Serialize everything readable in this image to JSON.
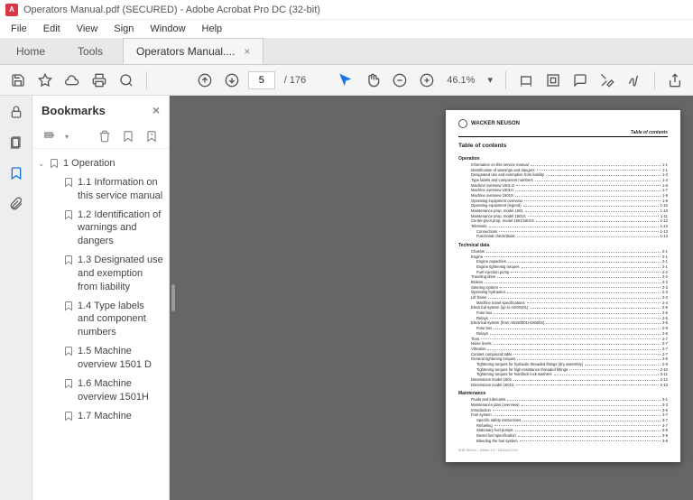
{
  "window": {
    "title": "Operators Manual.pdf (SECURED) - Adobe Acrobat Pro DC (32-bit)",
    "app_icon": "A"
  },
  "menu": {
    "file": "File",
    "edit": "Edit",
    "view": "View",
    "sign": "Sign",
    "window": "Window",
    "help": "Help"
  },
  "tabs": {
    "home": "Home",
    "tools": "Tools",
    "doc": "Operators Manual....",
    "close": "×"
  },
  "toolbar": {
    "page": "5",
    "total_pages": "/ 176",
    "zoom": "46.1%",
    "dropdown": "▾"
  },
  "sidebar": {
    "title": "Bookmarks",
    "close": "×",
    "root": "1 Operation",
    "items": [
      "1.1 Information on this service manual",
      "1.2 Identification of warnings and dangers",
      "1.3 Designated use and exemption from liability",
      "1.4 Type labels and component numbers",
      "1.5 Machine overview 1501 D",
      "1.6 Machine overview 1501H",
      "1.7 Machine"
    ]
  },
  "doc": {
    "brand": "WACKER NEUSON",
    "header_right": "Table of contents",
    "toc_title": "Table of contents",
    "sections": [
      {
        "title": "Operation",
        "rows": [
          {
            "t": "Information on this service manual",
            "p": "1-1",
            "i": 1
          },
          {
            "t": "Identification of warnings and dangers",
            "p": "1-1",
            "i": 1
          },
          {
            "t": "Designated use and exemption from liability",
            "p": "1-3",
            "i": 1
          },
          {
            "t": "Type labels and component numbers",
            "p": "1-4",
            "i": 1
          },
          {
            "t": "Machine overview 1501 D",
            "p": "1-6",
            "i": 1
          },
          {
            "t": "Machine overview 1501H",
            "p": "1-7",
            "i": 1
          },
          {
            "t": "Machine overview 1501S",
            "p": "1-8",
            "i": 1
          },
          {
            "t": "Operating equipment overview",
            "p": "1-9",
            "i": 1
          },
          {
            "t": "Operating equipment (legend)",
            "p": "1-10",
            "i": 1
          },
          {
            "t": "Maintenance prop, model 1501",
            "p": "1-10",
            "i": 1
          },
          {
            "t": "Maintenance prop, model 1501S",
            "p": "1-11",
            "i": 1
          },
          {
            "t": "Center-pivot prop, model 1501/1501S",
            "p": "1-12",
            "i": 1
          },
          {
            "t": "Telematic",
            "p": "1-13",
            "i": 1
          },
          {
            "t": "Connections",
            "p": "1-13",
            "i": 2
          },
          {
            "t": "Functional check/diode",
            "p": "1-13",
            "i": 2
          }
        ]
      },
      {
        "title": "Technical data",
        "rows": [
          {
            "t": "Chassis",
            "p": "2-1",
            "i": 1
          },
          {
            "t": "Engine",
            "p": "2-1",
            "i": 1
          },
          {
            "t": "Engine capacities",
            "p": "2-1",
            "i": 2
          },
          {
            "t": "Engine tightening torques",
            "p": "2-1",
            "i": 2
          },
          {
            "t": "Fuel injection pump",
            "p": "2-2",
            "i": 2
          },
          {
            "t": "Traveling drive",
            "p": "2-2",
            "i": 1
          },
          {
            "t": "Brakes",
            "p": "2-2",
            "i": 1
          },
          {
            "t": "Steering system",
            "p": "2-3",
            "i": 1
          },
          {
            "t": "Operating hydraulics",
            "p": "2-3",
            "i": 1
          },
          {
            "t": "Lift frame",
            "p": "2-3",
            "i": 1
          },
          {
            "t": "Machine travel specifications",
            "p": "2-4",
            "i": 2
          },
          {
            "t": "Electrical system (up to AG00101)",
            "p": "2-5",
            "i": 1
          },
          {
            "t": "Fuse box",
            "p": "2-5",
            "i": 2
          },
          {
            "t": "Relays",
            "p": "2-5",
            "i": 2
          },
          {
            "t": "Electrical system (from AB150001H150002)",
            "p": "2-6",
            "i": 1
          },
          {
            "t": "Fuse box",
            "p": "2-6",
            "i": 2
          },
          {
            "t": "Relays",
            "p": "2-6",
            "i": 2
          },
          {
            "t": "Tires",
            "p": "2-7",
            "i": 1
          },
          {
            "t": "Noise levels",
            "p": "2-7",
            "i": 1
          },
          {
            "t": "Vibration",
            "p": "2-7",
            "i": 1
          },
          {
            "t": "Coolant compound table",
            "p": "2-7",
            "i": 1
          },
          {
            "t": "General tightening torques",
            "p": "2-8",
            "i": 1
          },
          {
            "t": "Tightening torques for hydraulic threaded fittings (dry assembly)",
            "p": "2-8",
            "i": 2
          },
          {
            "t": "Tightening torques for high-resistance threaded fittings",
            "p": "2-10",
            "i": 2
          },
          {
            "t": "Tightening torques for Nordlock lock washers",
            "p": "2-11",
            "i": 2
          },
          {
            "t": "Dimensions model 1501",
            "p": "2-12",
            "i": 1
          },
          {
            "t": "Dimensions model 1501S",
            "p": "2-13",
            "i": 1
          }
        ]
      },
      {
        "title": "Maintenance",
        "rows": [
          {
            "t": "Fluids and lubricants",
            "p": "3-1",
            "i": 1
          },
          {
            "t": "Maintenance plan (overview)",
            "p": "3-3",
            "i": 1
          },
          {
            "t": "Introduction",
            "p": "3-6",
            "i": 1
          },
          {
            "t": "Fuel system",
            "p": "3-7",
            "i": 1
          },
          {
            "t": "Specific safety instructions",
            "p": "3-7",
            "i": 2
          },
          {
            "t": "Refueling",
            "p": "3-7",
            "i": 2
          },
          {
            "t": "Stationary fuel pumps",
            "p": "3-8",
            "i": 2
          },
          {
            "t": "Diesel fuel specification",
            "p": "3-8",
            "i": 2
          },
          {
            "t": "Bleeding the fuel system",
            "p": "3-8",
            "i": 2
          }
        ]
      }
    ],
    "footer": "SHB 1501en – Edition 1.5 * 1501a11VZ.fm"
  }
}
